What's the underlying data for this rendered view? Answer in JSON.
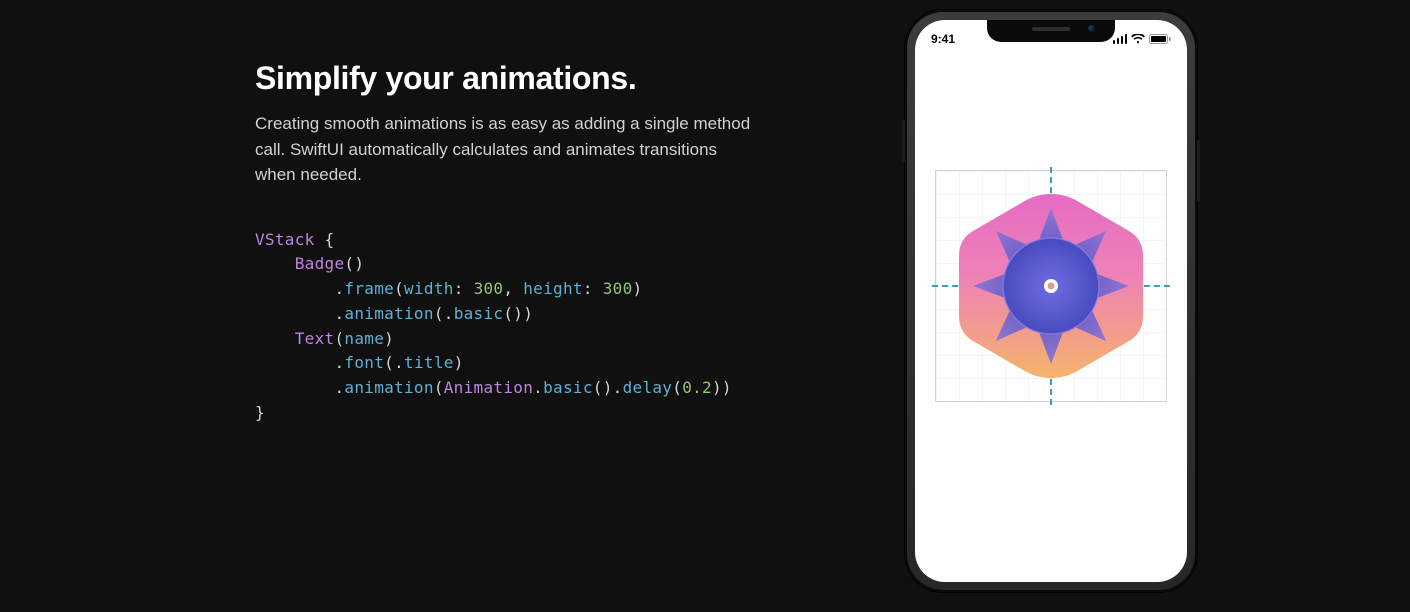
{
  "heading": "Simplify your animations.",
  "description": "Creating smooth animations is as easy as adding a single method call. SwiftUI automatically calculates and animates transitions when needed.",
  "code": {
    "line1_kw": "VStack",
    "line1_brace": " {",
    "line2_type": "Badge",
    "line2_rest": "()",
    "line3_dot": ".",
    "line3_fn": "frame",
    "line3_open": "(",
    "line3_arg1": "width",
    "line3_colon1": ": ",
    "line3_num1": "300",
    "line3_comma": ", ",
    "line3_arg2": "height",
    "line3_colon2": ": ",
    "line3_num2": "300",
    "line3_close": ")",
    "line4_dot": ".",
    "line4_fn": "animation",
    "line4_open": "(.",
    "line4_inner": "basic",
    "line4_close": "())",
    "line5_type": "Text",
    "line5_open": "(",
    "line5_arg": "name",
    "line5_close": ")",
    "line6_dot": ".",
    "line6_fn": "font",
    "line6_open": "(.",
    "line6_inner": "title",
    "line6_close": ")",
    "line7_dot": ".",
    "line7_fn": "animation",
    "line7_open": "(",
    "line7_type": "Animation",
    "line7_dot2": ".",
    "line7_basic": "basic",
    "line7_mid": "().",
    "line7_delay": "delay",
    "line7_open2": "(",
    "line7_num": "0.2",
    "line7_close": "))",
    "line8_brace": "}"
  },
  "phone": {
    "time": "9:41"
  }
}
